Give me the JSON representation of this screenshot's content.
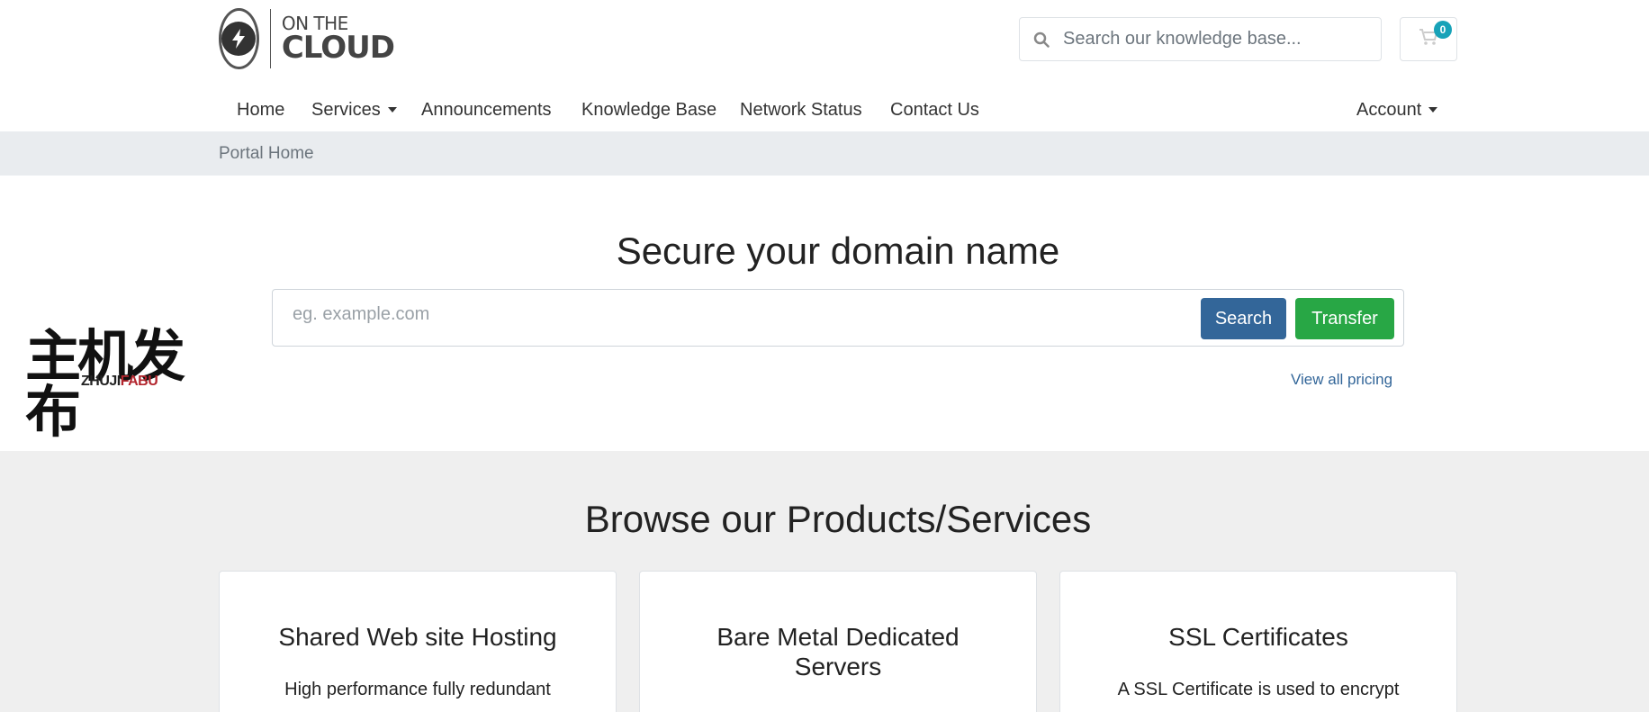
{
  "header": {
    "logo": {
      "line1": "ON THE",
      "line2": "CLOUD"
    },
    "search_placeholder": "Search our knowledge base...",
    "cart_count": "0"
  },
  "nav": {
    "items": [
      "Home",
      "Services",
      "Announcements",
      "Knowledge Base",
      "Network Status",
      "Contact Us"
    ],
    "account": "Account"
  },
  "breadcrumb": "Portal Home",
  "side_logo": {
    "cn": "主机发布",
    "en_a": "ZHUJI",
    "en_b": "FABU"
  },
  "domain": {
    "title": "Secure your domain name",
    "placeholder": "eg. example.com",
    "search_label": "Search",
    "transfer_label": "Transfer",
    "pricing_link": "View all pricing"
  },
  "products": {
    "title": "Browse our Products/Services",
    "cards": [
      {
        "title": "Shared Web site Hosting",
        "desc": "High performance fully redundant"
      },
      {
        "title": "Bare Metal Dedicated Servers",
        "desc": ""
      },
      {
        "title": "SSL Certificates",
        "desc": "A SSL Certificate is used to encrypt"
      }
    ]
  },
  "colors": {
    "primary": "#336699",
    "success": "#28a745",
    "badge": "#17a2b8",
    "breadcrumb_bg": "#e9ecef",
    "section_bg": "#efefef"
  }
}
